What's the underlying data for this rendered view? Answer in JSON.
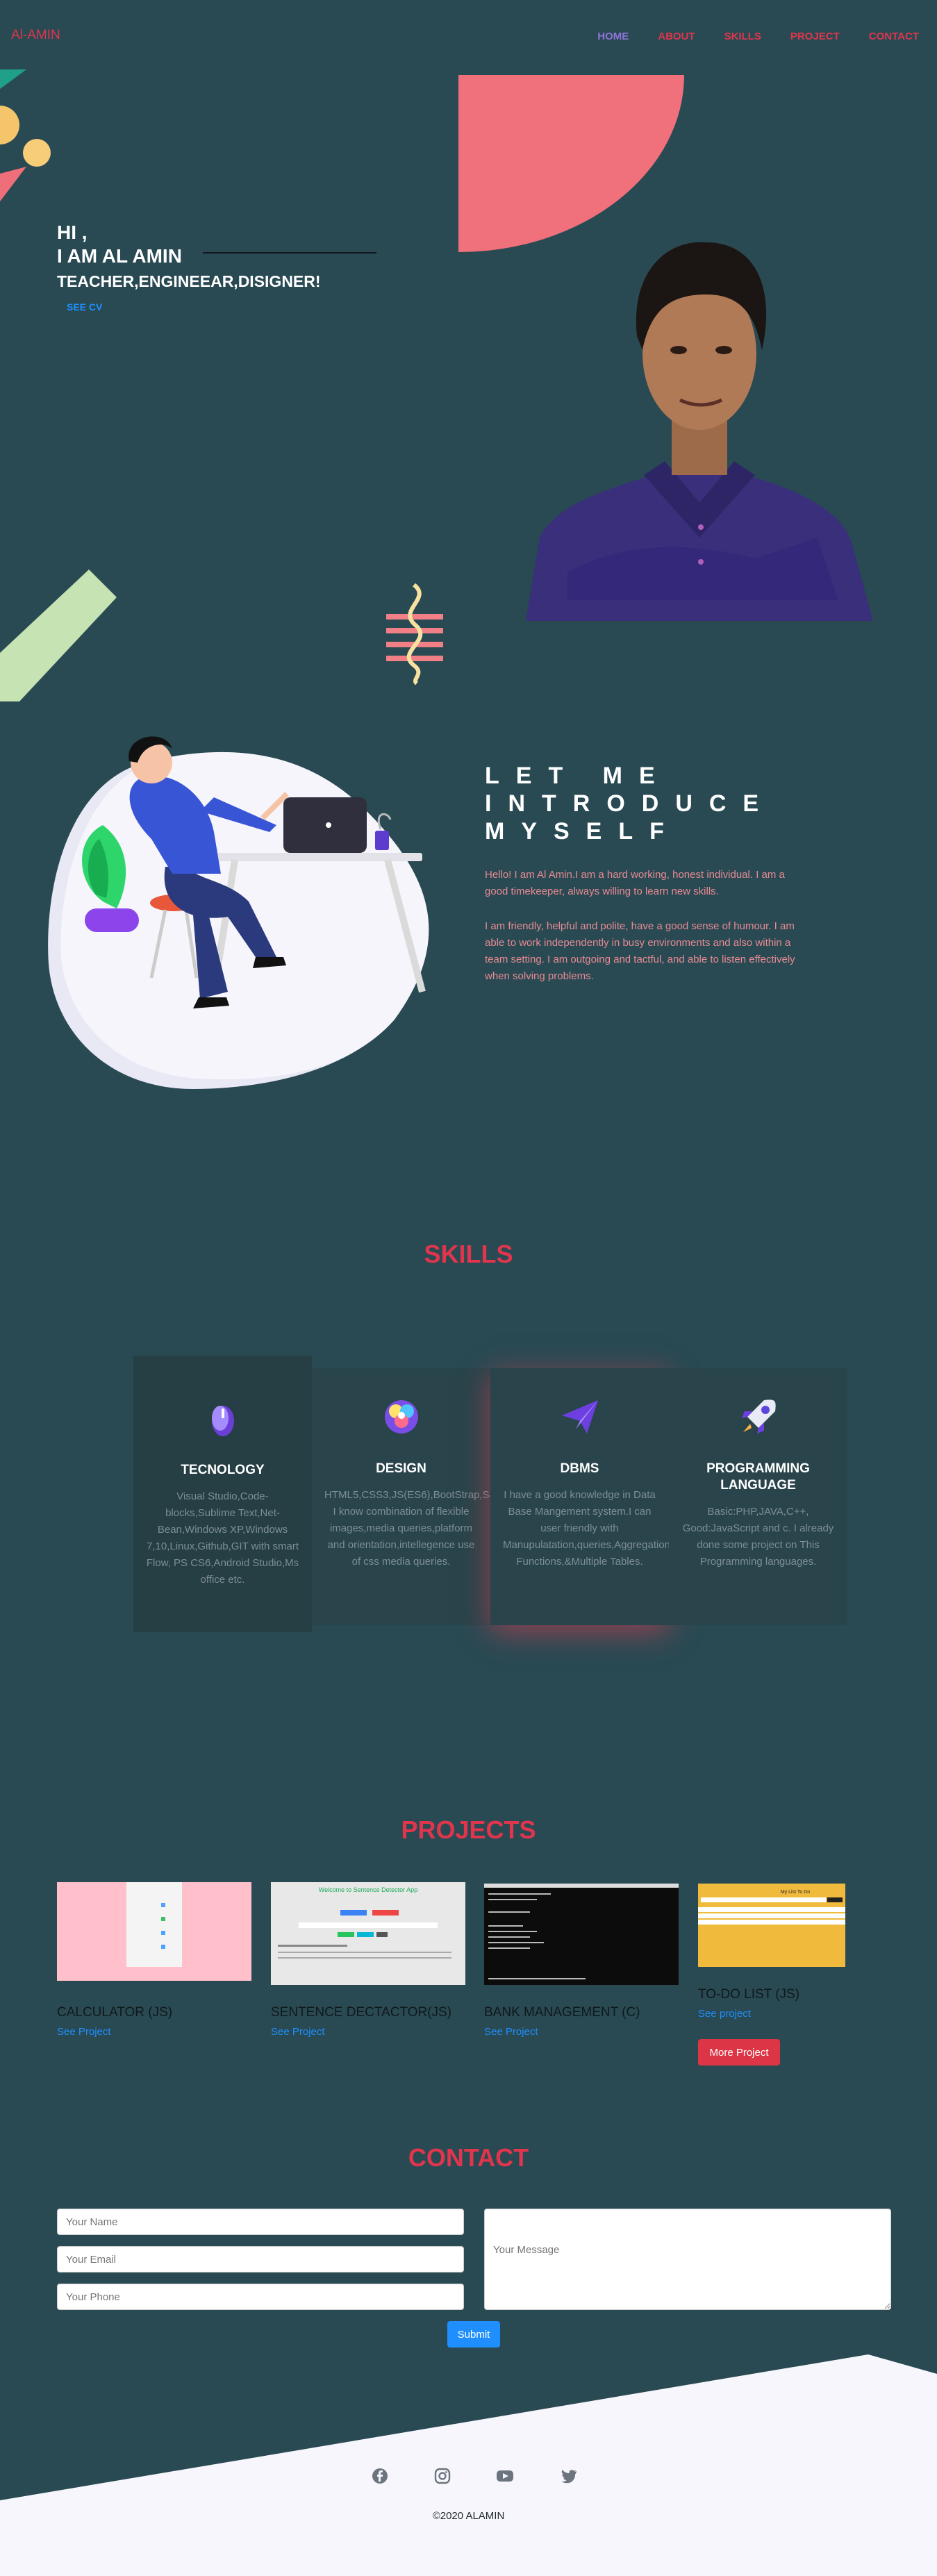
{
  "nav": {
    "brand": "Al-AMIN",
    "items": [
      {
        "label": "HOME",
        "active": true
      },
      {
        "label": "ABOUT",
        "active": false
      },
      {
        "label": "SKILLS",
        "active": false
      },
      {
        "label": "PROJECT",
        "active": false
      },
      {
        "label": "CONTACT",
        "active": false
      }
    ]
  },
  "hero": {
    "greeting": "HI ,",
    "name_line": "I AM AL AMIN",
    "roles": "TEACHER,ENGINEEAR,DISIGNER!",
    "cv_label": "SEE CV"
  },
  "about": {
    "title_lines": [
      "LET ME",
      "INTRODUCE",
      "MYSELF"
    ],
    "paragraph1": "Hello! I am Al Amin.I am a hard working, honest individual. I am a good timekeeper, always willing to learn new skills.",
    "paragraph2": "I am friendly, helpful and polite, have a good sense of humour. I am able to work independently in busy environments and also within a team setting. I am outgoing and tactful, and able to listen effectively when solving problems."
  },
  "skills": {
    "title": "SKILLS",
    "items": [
      {
        "name": "TECNOLOGY",
        "desc": "Visual Studio,Code-blocks,Sublime Text,Net-Bean,Windows XP,Windows 7,10,Linux,Github,GIT with smart Flow, PS CS6,Android Studio,Ms office etc.",
        "icon": "mouse-icon"
      },
      {
        "name": "DESIGN",
        "desc": "HTML5,CSS3,JS(ES6),BootStrap,Sass. I know combination of flexible images,media queries,platform and orientation,intellegence use of css media queries.",
        "icon": "palette-icon"
      },
      {
        "name": "DBMS",
        "desc": "I have a good knowledge in Data Base Mangement system.I can user friendly with Manupulatation,queries,Aggregation Functions,&Multiple Tables.",
        "icon": "paper-plane-icon"
      },
      {
        "name": "PROGRAMMING LANGUAGE",
        "desc": "Basic:PHP,JAVA,C++, Good:JavaScript and c. I already done some project on This Programming languages.",
        "icon": "rocket-icon"
      }
    ]
  },
  "projects": {
    "title": "PROJECTS",
    "items": [
      {
        "name": "CALCULATOR (JS)",
        "link": "See Project"
      },
      {
        "name": "SENTENCE DECTACTOR(JS)",
        "link": "See Project"
      },
      {
        "name": "BANK MANAGEMENT (C)",
        "link": "See Project"
      },
      {
        "name": "TO-DO LIST (JS)",
        "link": "See project"
      }
    ],
    "thumb2_heading": "Welcome to Sentence Detector App",
    "thumb4_heading": "My List To Do",
    "more_label": "More Project"
  },
  "contact": {
    "title": "CONTACT",
    "name_placeholder": "Your Name",
    "email_placeholder": "Your Email",
    "phone_placeholder": "Your Phone",
    "message_placeholder": "Your Message",
    "submit_label": "Submit"
  },
  "footer": {
    "socials": [
      "facebook-icon",
      "instagram-icon",
      "youtube-icon",
      "twitter-icon"
    ],
    "copyright": "©2020 ALAMIN"
  },
  "colors": {
    "background": "#294a53",
    "accent": "#e0354c",
    "link": "#1f8fff",
    "nav_active": "#8e74d8"
  }
}
